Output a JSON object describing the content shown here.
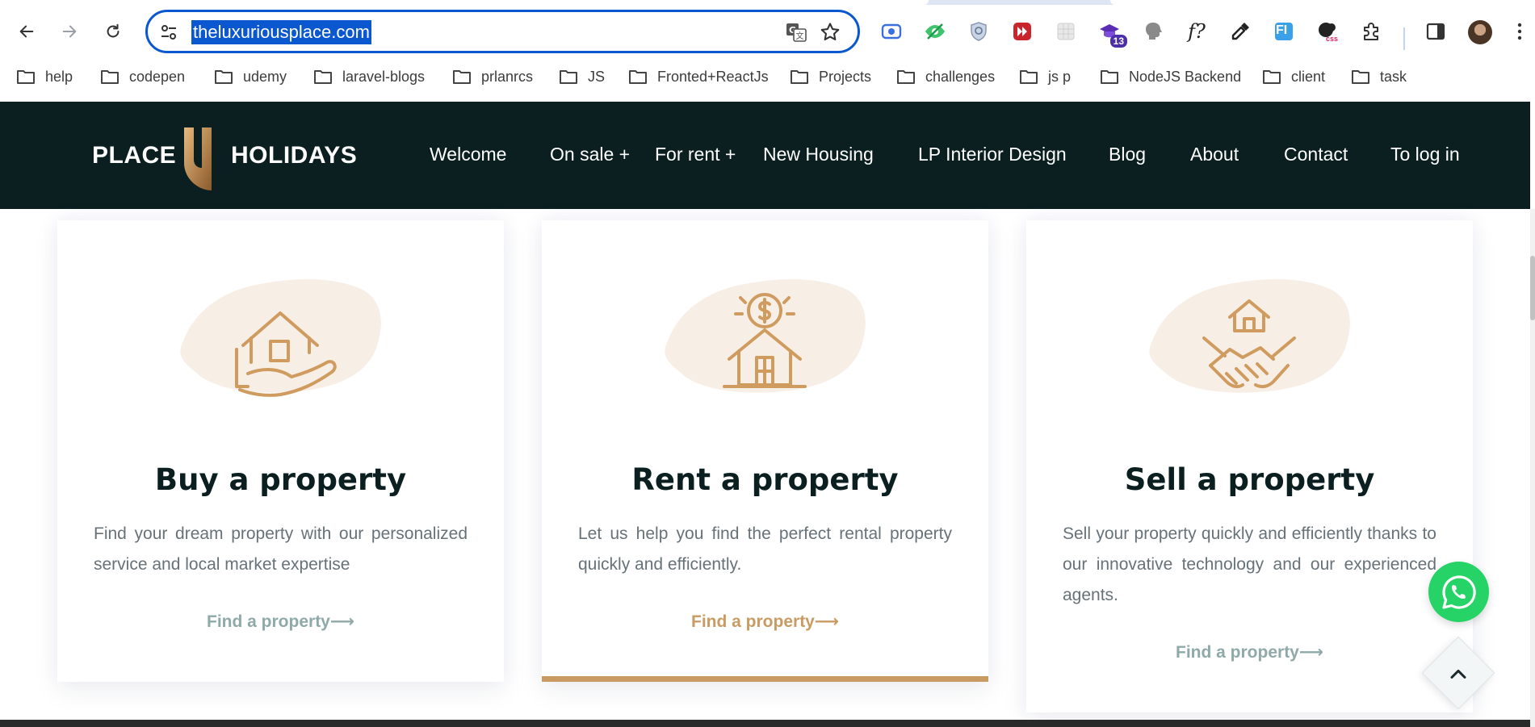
{
  "browser": {
    "url": "theluxuriousplace.com",
    "extension_badge": "13",
    "bookmarks": [
      "help",
      "codepen",
      "udemy",
      "laravel-blogs",
      "prlanrcs",
      "JS",
      "Fronted+ReactJs",
      "Projects",
      "challenges",
      "js p",
      "NodeJS Backend",
      "client",
      "task"
    ],
    "extension_f_label": "f?",
    "extension_fi_label": "FI",
    "extension_css_label": "css"
  },
  "site": {
    "logo_left": "PLACE",
    "logo_right": "HOLIDAYS",
    "nav": [
      "Welcome",
      "On sale +",
      "For rent +",
      "New Housing",
      "LP Interior Design",
      "Blog",
      "About",
      "Contact",
      "To log in"
    ]
  },
  "cards": [
    {
      "title": "Buy a property",
      "text": "Find your dream property with our personalized service and local market expertise",
      "link": "Find a property⟶",
      "icon": "house-in-hand-icon"
    },
    {
      "title": "Rent a property",
      "text": "Let us help you find the perfect rental property quickly and efficiently.",
      "link": "Find a property⟶",
      "icon": "house-dollar-icon"
    },
    {
      "title": "Sell a property",
      "text": "Sell your property quickly and efficiently thanks to our innovative technology and our experienced agents.",
      "link": "Find a property⟶",
      "icon": "house-handshake-icon"
    }
  ],
  "colors": {
    "header_bg": "#0b1f20",
    "accent_gold": "#c99b63",
    "link_muted": "#8fa9a9",
    "whatsapp_green": "#25d366",
    "omnibox_blue": "#0b57d0"
  }
}
